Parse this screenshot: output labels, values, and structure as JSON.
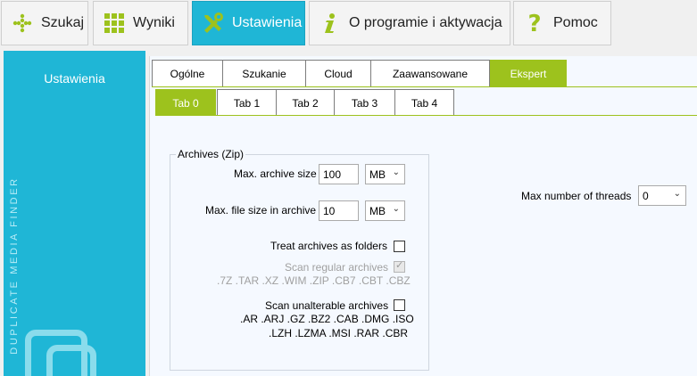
{
  "toolbar": {
    "buttons": [
      {
        "label": "Szukaj",
        "icon": "grid-dots-icon"
      },
      {
        "label": "Wyniki",
        "icon": "grid-squares-icon"
      },
      {
        "label": "Ustawienia",
        "icon": "tools-icon"
      },
      {
        "label": "O programie i aktywacja",
        "icon": "info-icon"
      },
      {
        "label": "Pomoc",
        "icon": "question-icon"
      }
    ],
    "active_color": "#1fb6d6",
    "icon_color": "#9dc21d"
  },
  "sidebar": {
    "title": "Ustawienia",
    "vertical_text": "DUPLICATE MEDIA FINDER"
  },
  "tabs": {
    "main": [
      "Ogólne",
      "Szukanie",
      "Cloud",
      "Zaawansowane",
      "Ekspert"
    ],
    "main_active": "Ekspert",
    "sub": [
      "Tab 0",
      "Tab 1",
      "Tab 2",
      "Tab 3",
      "Tab 4"
    ],
    "sub_active": "Tab 0",
    "accent": "#9dc21d"
  },
  "archives": {
    "legend": "Archives (Zip)",
    "max_archive_size_label": "Max. archive size",
    "max_archive_size_value": "100",
    "max_archive_size_unit": "MB",
    "max_file_size_label": "Max. file size in archive",
    "max_file_size_value": "10",
    "max_file_size_unit": "MB",
    "treat_as_folders_label": "Treat archives as folders",
    "treat_as_folders_checked": false,
    "scan_regular_label": "Scan regular archives",
    "scan_regular_checked": true,
    "scan_regular_formats": ".7Z .TAR .XZ .WIM .ZIP .CB7 .CBT .CBZ",
    "scan_unalterable_label": "Scan unalterable archives",
    "scan_unalterable_checked": false,
    "scan_unalterable_formats_1": ".AR .ARJ .GZ .BZ2 .CAB .DMG .ISO",
    "scan_unalterable_formats_2": ".LZH .LZMA .MSI .RAR .CBR"
  },
  "threads": {
    "label": "Max number of threads",
    "value": "0"
  }
}
